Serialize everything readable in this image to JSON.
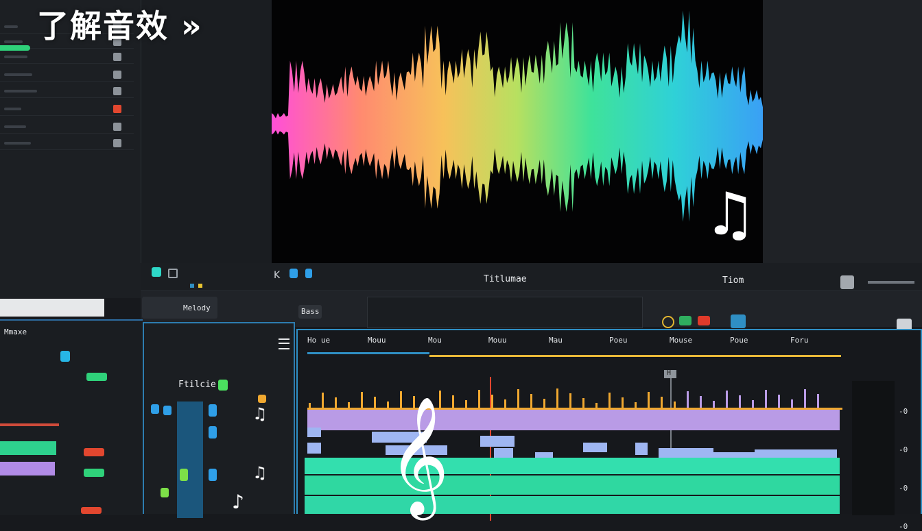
{
  "title": "了解音效 »",
  "preview": {
    "center_label": "Titlumae",
    "right_label": "Tiom",
    "note_icon": "music-note-icon"
  },
  "toolbar": {
    "track_label": "Melody",
    "play_label": "Bass"
  },
  "mixer": {
    "header": "Mmaxe",
    "track_name": "Ftilcie"
  },
  "timeline": {
    "ruler_marks": [
      "Ho ue",
      "Mouu",
      "Mou",
      "Mouu",
      "Mau",
      "Poeu",
      "Mouse",
      "Poue",
      "Foru"
    ],
    "playhead_label": "H",
    "right_scale": [
      "-0",
      "-0",
      "-0",
      "-0"
    ]
  },
  "icons": {
    "clef": "treble-clef-icon",
    "note": "music-note-icon",
    "menu": "hamburger-menu-icon"
  },
  "colors": {
    "accent_blue": "#2f8fc4",
    "green": "#2fd17a",
    "purple": "#b99be6",
    "orange": "#f0a830",
    "red": "#e03a2a"
  }
}
